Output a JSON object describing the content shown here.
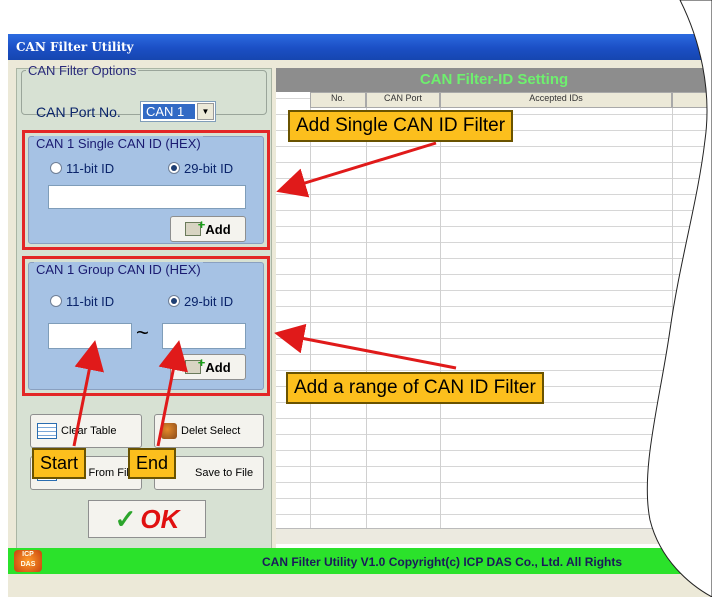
{
  "window": {
    "title": "CAN Filter Utility"
  },
  "options": {
    "legend": "CAN Filter Options",
    "port_label": "CAN Port No.",
    "port_value": "CAN 1"
  },
  "single": {
    "legend": "CAN 1 Single CAN ID (HEX)",
    "radio_11": "11-bit ID",
    "radio_29": "29-bit ID",
    "selected": "29-bit ID",
    "input_value": "",
    "add_label": "Add"
  },
  "group": {
    "legend": "CAN 1 Group CAN ID (HEX)",
    "radio_11": "11-bit ID",
    "radio_29": "29-bit ID",
    "selected": "29-bit ID",
    "from_value": "",
    "separator": "~",
    "to_value": "",
    "add_label": "Add"
  },
  "buttons": {
    "clear_table": "Clear Table",
    "delete_select": "Delet Select",
    "load_file": "Load From File",
    "save_file": "Save to File",
    "ok": "OK"
  },
  "table": {
    "header": "CAN Filter-ID Setting",
    "columns": [
      "No.",
      "CAN Port",
      "Accepted IDs"
    ]
  },
  "status": {
    "text": "CAN Filter Utility  V1.0    Copyright(c) ICP DAS Co., Ltd. All Rights",
    "logo_text": "ICP DAS"
  },
  "callouts": {
    "single": "Add Single CAN ID Filter",
    "range": "Add a range of CAN ID Filter",
    "start": "Start",
    "end": "End"
  },
  "colors": {
    "titlebar": "#1b4fc4",
    "panel": "#d7e1d3",
    "group_bg": "#a6c2e4",
    "highlight_border": "#e32626",
    "callout_bg": "#fcbf1d",
    "status_bg": "#2be22b",
    "header_text": "#6ef06e"
  }
}
